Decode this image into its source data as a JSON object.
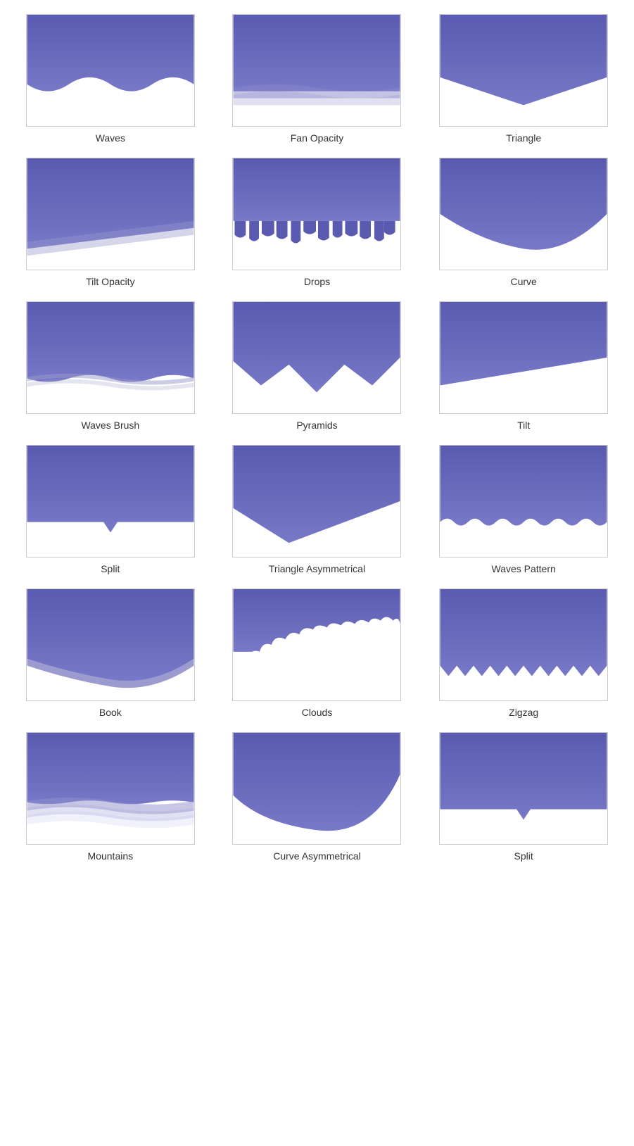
{
  "items": [
    {
      "id": "waves",
      "label": "Waves",
      "type": "waves"
    },
    {
      "id": "fan-opacity",
      "label": "Fan Opacity",
      "type": "fan-opacity"
    },
    {
      "id": "triangle",
      "label": "Triangle",
      "type": "triangle"
    },
    {
      "id": "tilt-opacity",
      "label": "Tilt Opacity",
      "type": "tilt-opacity"
    },
    {
      "id": "drops",
      "label": "Drops",
      "type": "drops"
    },
    {
      "id": "curve",
      "label": "Curve",
      "type": "curve"
    },
    {
      "id": "waves-brush",
      "label": "Waves Brush",
      "type": "waves-brush"
    },
    {
      "id": "pyramids",
      "label": "Pyramids",
      "type": "pyramids"
    },
    {
      "id": "tilt",
      "label": "Tilt",
      "type": "tilt"
    },
    {
      "id": "split",
      "label": "Split",
      "type": "split"
    },
    {
      "id": "triangle-asymmetrical",
      "label": "Triangle Asymmetrical",
      "type": "triangle-asymmetrical"
    },
    {
      "id": "waves-pattern",
      "label": "Waves Pattern",
      "type": "waves-pattern"
    },
    {
      "id": "book",
      "label": "Book",
      "type": "book"
    },
    {
      "id": "clouds",
      "label": "Clouds",
      "type": "clouds"
    },
    {
      "id": "zigzag",
      "label": "Zigzag",
      "type": "zigzag"
    },
    {
      "id": "mountains",
      "label": "Mountains",
      "type": "mountains"
    },
    {
      "id": "curve-asymmetrical",
      "label": "Curve Asymmetrical",
      "type": "curve-asymmetrical"
    },
    {
      "id": "split2",
      "label": "Split",
      "type": "split2"
    }
  ],
  "colors": {
    "purple_light": "#7b7bc8",
    "purple_dark": "#5a5aab",
    "purple_mid": "#6868bb"
  }
}
